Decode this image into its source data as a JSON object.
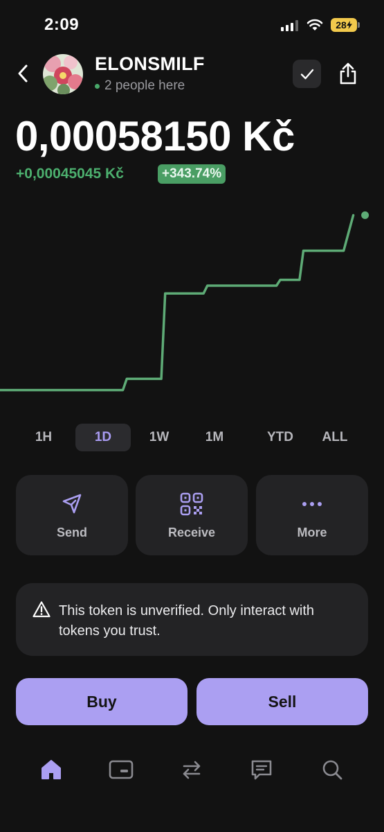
{
  "status_bar": {
    "time": "2:09",
    "battery": "28"
  },
  "header": {
    "token_name": "ELONSMILF",
    "presence": "2 people here"
  },
  "price": {
    "value": "0,00058150 Kč",
    "change": "+0,00045045 Kč",
    "change_pct": "+343.74%"
  },
  "colors": {
    "accent": "#ab9ff2",
    "positive": "#4caf6e",
    "chart_line": "#5eab76",
    "background": "#121212",
    "card": "#232325"
  },
  "chart_data": {
    "type": "line",
    "series": [
      {
        "values": [
          0.00013105,
          0.00013105,
          0.00016,
          0.00016,
          0.00038,
          0.00038,
          0.0004,
          0.0004,
          0.000415,
          0.000415,
          0.00049,
          0.00049,
          0.0005815
        ]
      }
    ],
    "x": [
      0,
      0.32,
      0.33,
      0.42,
      0.43,
      0.53,
      0.54,
      0.72,
      0.73,
      0.78,
      0.79,
      0.895,
      0.92
    ],
    "ylim": [
      0.0001,
      0.0006
    ],
    "grid": false
  },
  "timeframes": [
    "1H",
    "1D",
    "1W",
    "1M",
    "YTD",
    "ALL"
  ],
  "active_timeframe": "1D",
  "actions": {
    "send": "Send",
    "receive": "Receive",
    "more": "More"
  },
  "warning": {
    "icon": "warning-triangle-icon",
    "text": "This token is unverified. Only interact with tokens you trust."
  },
  "trade": {
    "buy": "Buy",
    "sell": "Sell"
  },
  "nav_icons": [
    "home-icon",
    "wallet-icon",
    "swap-icon",
    "chat-icon",
    "search-icon"
  ]
}
